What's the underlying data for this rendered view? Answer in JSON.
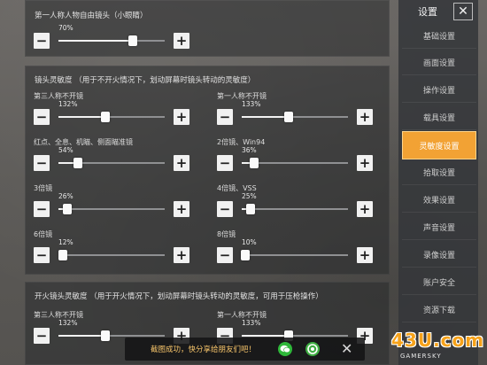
{
  "panels": {
    "first_person_free_look": {
      "title": "第一人称人物自由镜头（小眼睛）",
      "sliders": [
        {
          "label": "",
          "value_text": "70%",
          "value": 0.7
        }
      ]
    },
    "scope_sensitivity": {
      "title": "镜头灵敏度 （用于不开火情况下，划动屏幕时镜头转动的灵敏度）",
      "sliders": [
        {
          "label": "第三人称不开镜",
          "value_text": "132%",
          "value": 0.44
        },
        {
          "label": "第一人称不开镜",
          "value_text": "133%",
          "value": 0.443
        },
        {
          "label": "红点、全息、机瞄、侧面瞄准镜",
          "value_text": "54%",
          "value": 0.18
        },
        {
          "label": "2倍镜、Win94",
          "value_text": "36%",
          "value": 0.12
        },
        {
          "label": "3倍镜",
          "value_text": "26%",
          "value": 0.087
        },
        {
          "label": "4倍镜、VSS",
          "value_text": "25%",
          "value": 0.083
        },
        {
          "label": "6倍镜",
          "value_text": "12%",
          "value": 0.04
        },
        {
          "label": "8倍镜",
          "value_text": "10%",
          "value": 0.033
        }
      ]
    },
    "firing_sensitivity": {
      "title": "开火镜头灵敏度 （用于开火情况下，划动屏幕时镜头转动的灵敏度，可用于压枪操作）",
      "sliders": [
        {
          "label": "第三人称不开镜",
          "value_text": "132%",
          "value": 0.44
        },
        {
          "label": "第一人称不开镜",
          "value_text": "133%",
          "value": 0.443
        }
      ]
    }
  },
  "sidebar": {
    "title": "设置",
    "close_glyph": "✕",
    "items": [
      {
        "label": "基础设置",
        "active": false
      },
      {
        "label": "画面设置",
        "active": false
      },
      {
        "label": "操作设置",
        "active": false
      },
      {
        "label": "载具设置",
        "active": false
      },
      {
        "label": "灵敏度设置",
        "active": true
      },
      {
        "label": "拾取设置",
        "active": false
      },
      {
        "label": "效果设置",
        "active": false
      },
      {
        "label": "声音设置",
        "active": false
      },
      {
        "label": "录像设置",
        "active": false
      },
      {
        "label": "账户安全",
        "active": false
      },
      {
        "label": "资源下载",
        "active": false
      }
    ]
  },
  "toast": {
    "text": "截图成功，快分享给朋友们吧！",
    "icons": [
      "wechat-icon",
      "moments-icon"
    ],
    "close_glyph": "✕"
  },
  "watermark": {
    "logo": "43U.com",
    "sub": "GAMERSKY"
  },
  "colors": {
    "accent": "#f2a234",
    "button_bg": "#f1f1f1",
    "track": "#8f9092",
    "toast_text": "#f6c46a"
  }
}
